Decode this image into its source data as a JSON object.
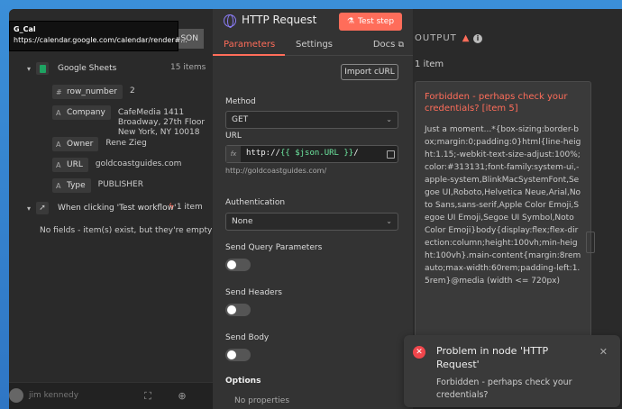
{
  "tooltip": {
    "title": "G_Cal",
    "url": "https://calendar.google.com/calendar/render#..."
  },
  "left": {
    "json_button": "SON",
    "sheets_node": {
      "label": "Google Sheets",
      "count": "15 items"
    },
    "fields": [
      {
        "icon": "#",
        "name": "row_number",
        "value": "2"
      },
      {
        "icon": "A",
        "name": "Company",
        "value_lines": [
          "CafeMedia 1411",
          "Broadway, 27th Floor",
          "New York, NY 10018"
        ]
      },
      {
        "icon": "A",
        "name": "Owner",
        "value": "Rene Zieg"
      },
      {
        "icon": "A",
        "name": "URL",
        "value": "goldcoastguides.com"
      },
      {
        "icon": "A",
        "name": "Type",
        "value": "PUBLISHER"
      }
    ],
    "trigger_node": {
      "label": "When clicking 'Test workflow'",
      "count": "1 item"
    },
    "no_fields": "No fields - item(s) exist, but they're empty",
    "user_name": "jim kennedy"
  },
  "center": {
    "title": "HTTP Request",
    "test_step": "Test step",
    "tabs": {
      "parameters": "Parameters",
      "settings": "Settings",
      "docs": "Docs"
    },
    "import_curl": "Import cURL",
    "method_label": "Method",
    "method_value": "GET",
    "url_label": "URL",
    "url_prefix": "http://",
    "url_expr": "{{ $json.URL }}",
    "url_suffix": "/",
    "url_hint": "http://goldcoastguides.com/",
    "auth_label": "Authentication",
    "auth_value": "None",
    "send_query": "Send Query Parameters",
    "send_headers": "Send Headers",
    "send_body": "Send Body",
    "options": "Options",
    "no_properties": "No properties"
  },
  "right": {
    "output_label": "OUTPUT",
    "items": "1 item",
    "error_title": "Forbidden - perhaps check your credentials? [item 5]",
    "error_body": "Just a moment...*{box-sizing:border-box;margin:0;padding:0}html{line-height:1.15;-webkit-text-size-adjust:100%;color:#313131;font-family:system-ui,-apple-system,BlinkMacSystemFont,Segoe UI,Roboto,Helvetica Neue,Arial,Noto Sans,sans-serif,Apple Color Emoji,Segoe UI Emoji,Segoe UI Symbol,Noto Color Emoji}body{display:flex;flex-direction:column;height:100vh;min-height:100vh}.main-content{margin:8rem auto;max-width:60rem;padding-left:1.5rem}@media (width <= 720px)"
  },
  "toast": {
    "title": "Problem in node 'HTTP Request'",
    "body": "Forbidden - perhaps check your credentials?"
  },
  "colors": {
    "accent": "#ff6d5a",
    "error": "#f0464c",
    "sheets_green": "#1ea362",
    "expression": "#6ee7a0"
  }
}
